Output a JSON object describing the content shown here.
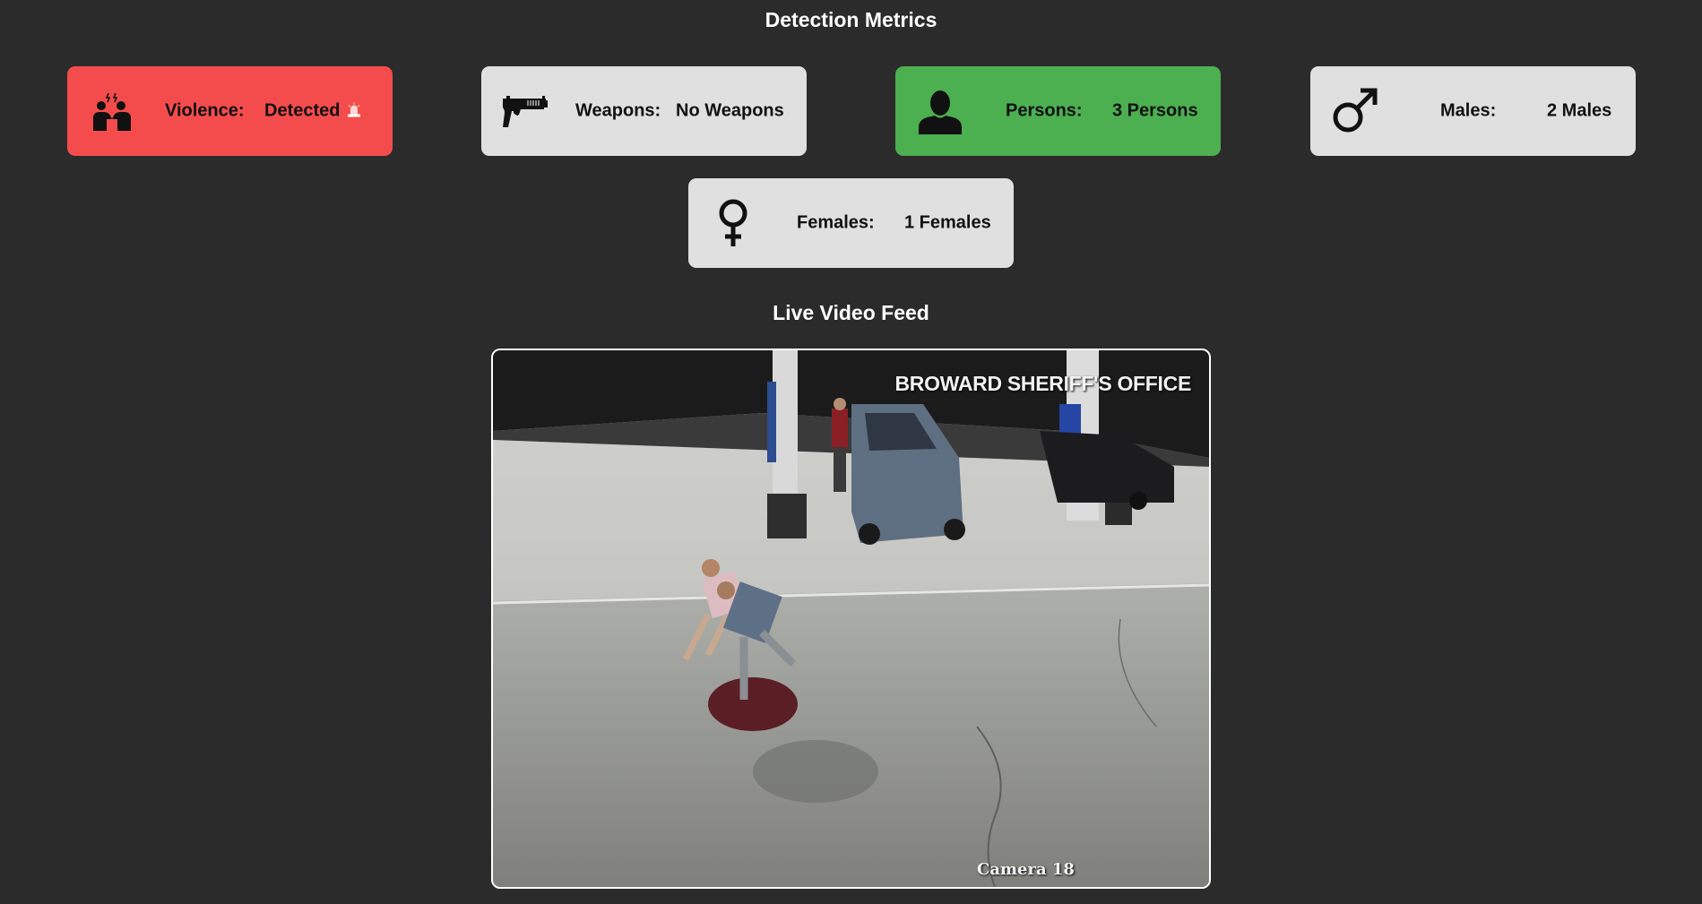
{
  "metrics_title": "Detection Metrics",
  "cards": {
    "violence": {
      "label": "Violence:",
      "value": "Detected",
      "status_icon": "alarm-icon",
      "icon": "fighting-people-icon",
      "color": "#f44c4c"
    },
    "weapons": {
      "label": "Weapons:",
      "value": "No Weapons",
      "icon": "pistol-icon",
      "color": "#e0e0e0"
    },
    "persons": {
      "label": "Persons:",
      "value": "3 Persons",
      "icon": "person-silhouette-icon",
      "color": "#4caf50"
    },
    "males": {
      "label": "Males:",
      "value": "2 Males",
      "icon": "male-symbol-icon",
      "color": "#e0e0e0"
    },
    "females": {
      "label": "Females:",
      "value": "1 Females",
      "icon": "female-symbol-icon",
      "color": "#e0e0e0"
    }
  },
  "video": {
    "title": "Live Video Feed",
    "source_label": "BROWARD SHERIFF'S OFFICE",
    "camera_label": "Camera 18"
  },
  "colors": {
    "background": "#2b2b2b",
    "alert": "#f44c4c",
    "ok": "#4caf50",
    "neutral": "#e0e0e0"
  }
}
